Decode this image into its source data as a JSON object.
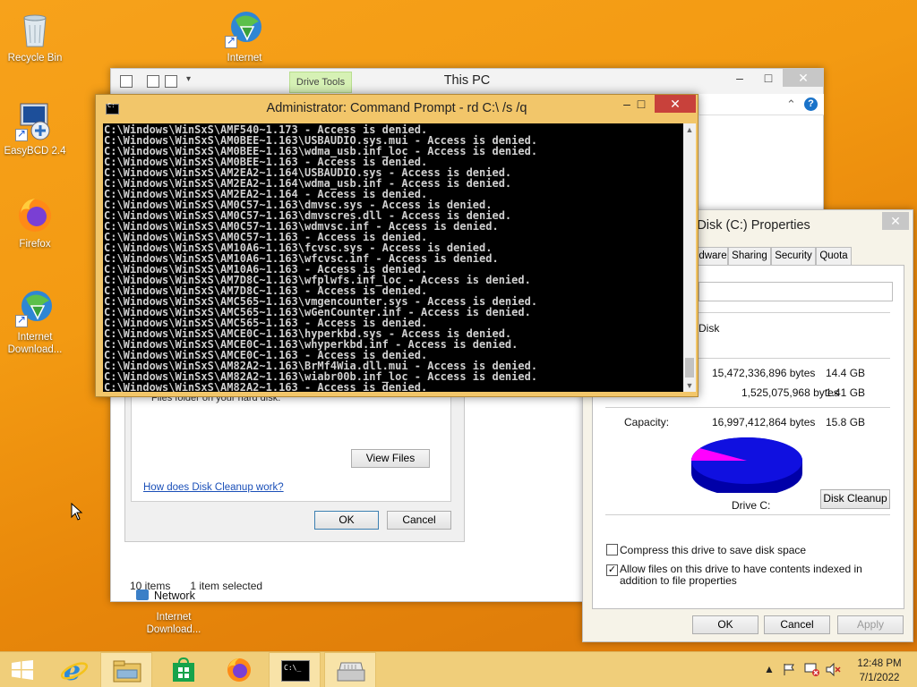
{
  "desktop": {
    "icons": [
      {
        "label": "Recycle Bin",
        "icon": "recycle-bin-icon"
      },
      {
        "label": "Internet",
        "icon": "internet-download-manager-icon"
      },
      {
        "label": "EasyBCD 2.4",
        "icon": "easybcd-icon"
      },
      {
        "label": "Firefox",
        "icon": "firefox-icon"
      },
      {
        "label": "Internet Download...",
        "icon": "internet-download-manager-icon"
      },
      {
        "label": "Internet Download...",
        "icon": "internet-download-manager-icon"
      }
    ]
  },
  "explorer": {
    "title": "This PC",
    "ribbon_context_tab": "Drive Tools",
    "sidebar_network": "Network",
    "status_items": "10 items",
    "status_selected": "1 item selected"
  },
  "cleanup": {
    "fragment_text": "Files folder on your hard disk.",
    "view_files": "View Files",
    "how_link": "How does Disk Cleanup work?",
    "ok": "OK",
    "cancel": "Cancel"
  },
  "cmd": {
    "title": "Administrator: Command Prompt - rd  C:\\ /s /q",
    "lines": [
      "C:\\Windows\\WinSxS\\AMF540~1.173 - Access is denied.",
      "C:\\Windows\\WinSxS\\AM0BEE~1.163\\USBAUDIO.sys.mui - Access is denied.",
      "C:\\Windows\\WinSxS\\AM0BEE~1.163\\wdma_usb.inf_loc - Access is denied.",
      "C:\\Windows\\WinSxS\\AM0BEE~1.163 - Access is denied.",
      "C:\\Windows\\WinSxS\\AM2EA2~1.164\\USBAUDIO.sys - Access is denied.",
      "C:\\Windows\\WinSxS\\AM2EA2~1.164\\wdma_usb.inf - Access is denied.",
      "C:\\Windows\\WinSxS\\AM2EA2~1.164 - Access is denied.",
      "C:\\Windows\\WinSxS\\AM0C57~1.163\\dmvsc.sys - Access is denied.",
      "C:\\Windows\\WinSxS\\AM0C57~1.163\\dmvscres.dll - Access is denied.",
      "C:\\Windows\\WinSxS\\AM0C57~1.163\\wdmvsc.inf - Access is denied.",
      "C:\\Windows\\WinSxS\\AM0C57~1.163 - Access is denied.",
      "C:\\Windows\\WinSxS\\AM10A6~1.163\\fcvsc.sys - Access is denied.",
      "C:\\Windows\\WinSxS\\AM10A6~1.163\\wfcvsc.inf - Access is denied.",
      "C:\\Windows\\WinSxS\\AM10A6~1.163 - Access is denied.",
      "C:\\Windows\\WinSxS\\AM7D8C~1.163\\wfplwfs.inf_loc - Access is denied.",
      "C:\\Windows\\WinSxS\\AM7D8C~1.163 - Access is denied.",
      "C:\\Windows\\WinSxS\\AMC565~1.163\\vmgencounter.sys - Access is denied.",
      "C:\\Windows\\WinSxS\\AMC565~1.163\\wGenCounter.inf - Access is denied.",
      "C:\\Windows\\WinSxS\\AMC565~1.163 - Access is denied.",
      "C:\\Windows\\WinSxS\\AMCE0C~1.163\\hyperkbd.sys - Access is denied.",
      "C:\\Windows\\WinSxS\\AMCE0C~1.163\\whyperkbd.inf - Access is denied.",
      "C:\\Windows\\WinSxS\\AMCE0C~1.163 - Access is denied.",
      "C:\\Windows\\WinSxS\\AM82A2~1.163\\BrMf4Wia.dll.mui - Access is denied.",
      "C:\\Windows\\WinSxS\\AM82A2~1.163\\wiabr00b.inf_loc - Access is denied.",
      "C:\\Windows\\WinSxS\\AM82A2~1.163 - Access is denied."
    ]
  },
  "props": {
    "title": "al Disk (C:) Properties",
    "tabs": [
      "dware",
      "Sharing",
      "Security",
      "Quota"
    ],
    "type_fragment": "Disk",
    "used_bytes": "15,472,336,896 bytes",
    "used_gb": "14.4 GB",
    "free_bytes": "1,525,075,968 bytes",
    "free_gb": "1.41 GB",
    "capacity_label": "Capacity:",
    "capacity_bytes": "16,997,412,864 bytes",
    "capacity_gb": "15.8 GB",
    "drive_label": "Drive C:",
    "disk_cleanup": "Disk Cleanup",
    "compress_label": "Compress this drive to save disk space",
    "index_label": "Allow files on this drive to have contents indexed in addition to file properties",
    "ok": "OK",
    "cancel": "Cancel",
    "apply": "Apply",
    "pie": {
      "used_fraction": 0.91,
      "used_color": "#1010e0",
      "free_color": "#ff00ff"
    }
  },
  "taskbar": {
    "apps": [
      "windows-logo-icon",
      "internet-explorer-icon",
      "file-explorer-icon",
      "store-icon",
      "firefox-icon",
      "cmd-icon",
      "disk-cleanup-icon"
    ],
    "time": "12:48 PM",
    "date": "7/1/2022"
  }
}
